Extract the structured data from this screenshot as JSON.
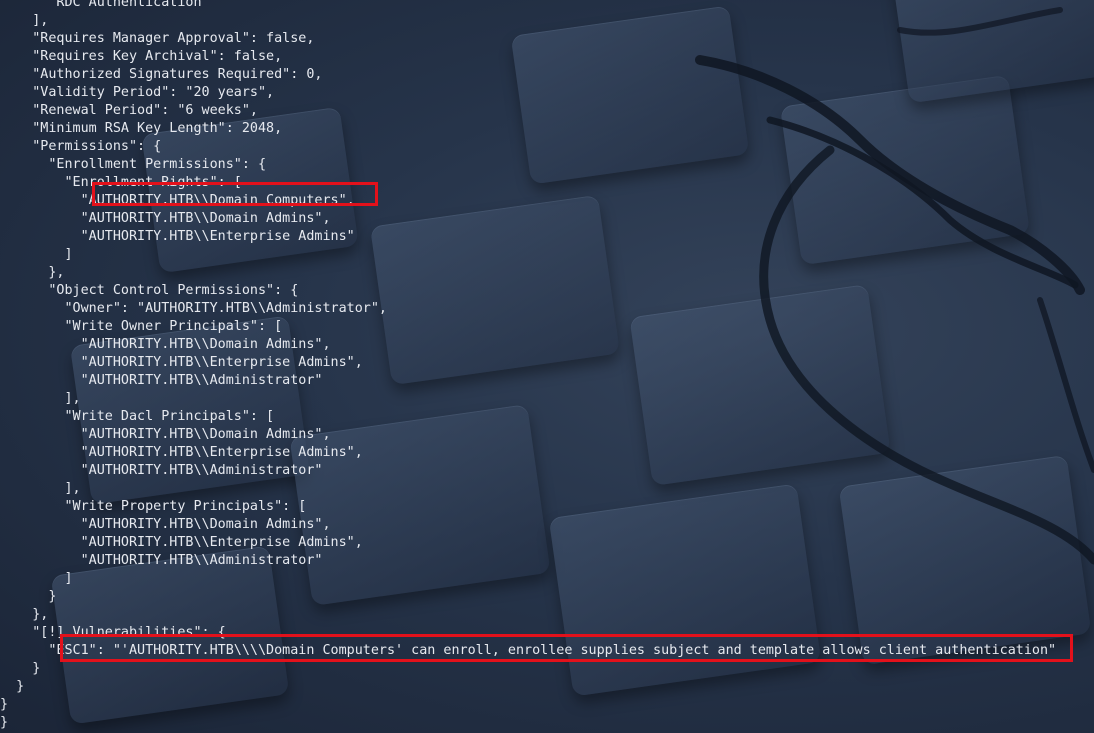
{
  "terminal": {
    "lines": [
      "      \"RDC Authentication\"",
      "    ],",
      "    \"Requires Manager Approval\": false,",
      "    \"Requires Key Archival\": false,",
      "    \"Authorized Signatures Required\": 0,",
      "    \"Validity Period\": \"20 years\",",
      "    \"Renewal Period\": \"6 weeks\",",
      "    \"Minimum RSA Key Length\": 2048,",
      "    \"Permissions\": {",
      "      \"Enrollment Permissions\": {",
      "        \"Enrollment Rights\": [",
      "          \"AUTHORITY.HTB\\\\Domain Computers\",",
      "          \"AUTHORITY.HTB\\\\Domain Admins\",",
      "          \"AUTHORITY.HTB\\\\Enterprise Admins\"",
      "        ]",
      "      },",
      "      \"Object Control Permissions\": {",
      "        \"Owner\": \"AUTHORITY.HTB\\\\Administrator\",",
      "        \"Write Owner Principals\": [",
      "          \"AUTHORITY.HTB\\\\Domain Admins\",",
      "          \"AUTHORITY.HTB\\\\Enterprise Admins\",",
      "          \"AUTHORITY.HTB\\\\Administrator\"",
      "        ],",
      "        \"Write Dacl Principals\": [",
      "          \"AUTHORITY.HTB\\\\Domain Admins\",",
      "          \"AUTHORITY.HTB\\\\Enterprise Admins\",",
      "          \"AUTHORITY.HTB\\\\Administrator\"",
      "        ],",
      "        \"Write Property Principals\": [",
      "          \"AUTHORITY.HTB\\\\Domain Admins\",",
      "          \"AUTHORITY.HTB\\\\Enterprise Admins\",",
      "          \"AUTHORITY.HTB\\\\Administrator\"",
      "        ]",
      "      }",
      "    },",
      "    \"[!] Vulnerabilities\": {",
      "      \"ESC1\": \"'AUTHORITY.HTB\\\\\\\\Domain Computers' can enroll, enrollee supplies subject and template allows client authentication\"",
      "    }",
      "  }",
      "}",
      "}"
    ]
  },
  "highlights": [
    {
      "name": "highlight-domain-computers-enrollment",
      "line": 11
    },
    {
      "name": "highlight-esc1-vulnerability",
      "line": 36
    }
  ],
  "colors": {
    "text": "#e6e9ef",
    "highlight_border": "#e3111b",
    "background": "#26344a"
  }
}
